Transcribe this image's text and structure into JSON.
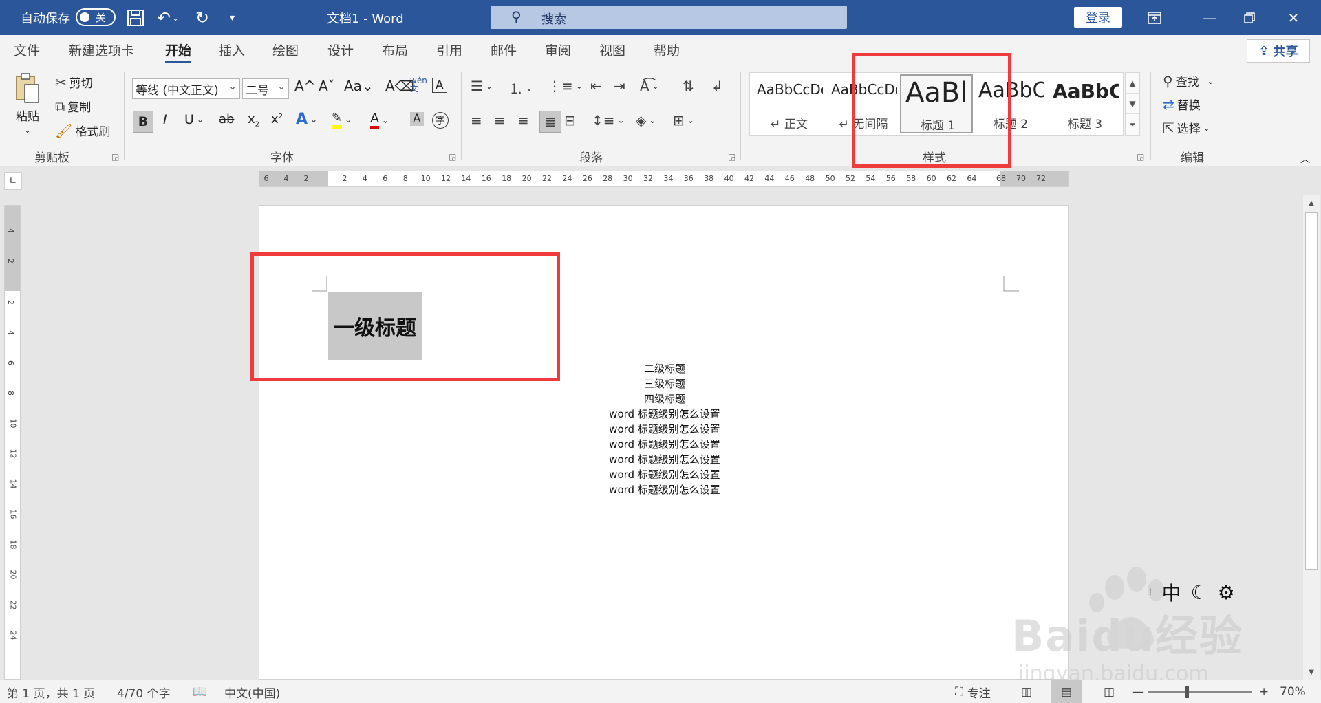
{
  "titlebar": {
    "autosave_label": "自动保存",
    "autosave_state": "关",
    "doc_title": "文档1  -  Word",
    "search_placeholder": "搜索",
    "login_label": "登录"
  },
  "tabs": [
    "文件",
    "新建选项卡",
    "开始",
    "插入",
    "绘图",
    "设计",
    "布局",
    "引用",
    "邮件",
    "审阅",
    "视图",
    "帮助"
  ],
  "active_tab": "开始",
  "share_label": "共享",
  "clipboard": {
    "paste": "粘贴",
    "cut": "剪切",
    "copy": "复制",
    "format_painter": "格式刷",
    "group": "剪贴板"
  },
  "font": {
    "family": "等线 (中文正文)",
    "size": "二号",
    "group": "字体"
  },
  "paragraph": {
    "group": "段落"
  },
  "styles": {
    "group": "样式",
    "items": [
      {
        "sample": "AaBbCcDc",
        "name": "正文"
      },
      {
        "sample": "AaBbCcDc",
        "name": "无间隔"
      },
      {
        "sample": "AaBl",
        "name": "标题 1"
      },
      {
        "sample": "AaBbC",
        "name": "标题 2"
      },
      {
        "sample": "AaBbC",
        "name": "标题 3"
      }
    ],
    "selected_index": 2
  },
  "editing": {
    "find": "查找",
    "replace": "替换",
    "select": "选择",
    "group": "编辑"
  },
  "ruler": {
    "h_ticks": [
      "6",
      "4",
      "2",
      "2",
      "4",
      "6",
      "8",
      "10",
      "12",
      "14",
      "16",
      "18",
      "20",
      "22",
      "24",
      "26",
      "28",
      "30",
      "32",
      "34",
      "36",
      "38",
      "40",
      "42",
      "44",
      "46",
      "48",
      "50",
      "52",
      "54",
      "56",
      "58",
      "60",
      "62",
      "64",
      "68",
      "70",
      "72"
    ],
    "v_ticks": [
      "4",
      "2",
      "2",
      "4",
      "6",
      "8",
      "10",
      "12",
      "14",
      "16",
      "18",
      "20",
      "22",
      "24"
    ]
  },
  "document": {
    "heading1": "一级标题",
    "lines": [
      "二级标题",
      "三级标题",
      "四级标题",
      "word 标题级别怎么设置",
      "word 标题级别怎么设置",
      "word 标题级别怎么设置",
      "word 标题级别怎么设置",
      "word 标题级别怎么设置",
      "word 标题级别怎么设置"
    ]
  },
  "ime": {
    "mode": "中"
  },
  "watermark": {
    "brand": "Baidu经验",
    "url": "jingyan.baidu.com"
  },
  "status": {
    "page": "第 1 页，共 1 页",
    "words": "4/70 个字",
    "language": "中文(中国)",
    "focus": "专注",
    "zoom": "70%"
  },
  "colors": {
    "accent": "#2b579a",
    "highlight_box": "#ef3b3b",
    "heading_shading": "#c8c8c8"
  }
}
